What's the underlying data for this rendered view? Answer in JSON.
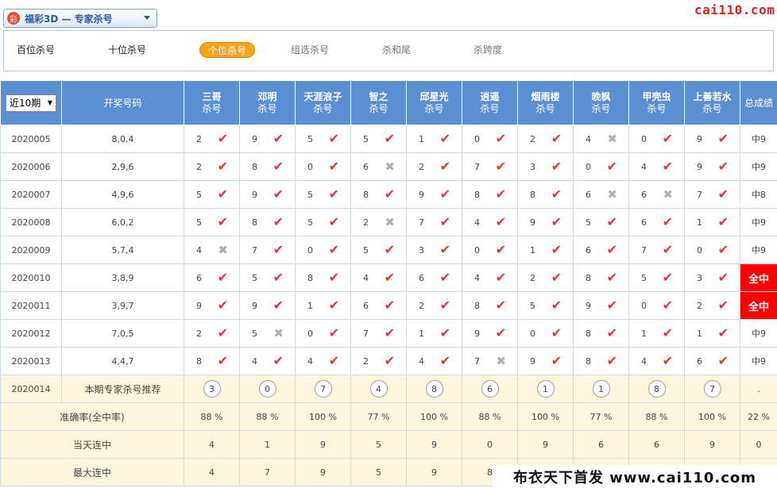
{
  "top": {
    "lottery_logo": "彩",
    "lottery_title": "福彩3D — 专家杀号",
    "site_logo": "cai110.com"
  },
  "tabs": [
    {
      "label": "百位杀号",
      "state": "normal"
    },
    {
      "label": "十位杀号",
      "state": "normal"
    },
    {
      "label": "个位杀号",
      "state": "active"
    },
    {
      "label": "组选杀号",
      "state": "inactive"
    },
    {
      "label": "杀和尾",
      "state": "inactive"
    },
    {
      "label": "杀跨度",
      "state": "inactive"
    }
  ],
  "header": {
    "period_select": "近10期",
    "draw_col": "开奖号码",
    "kill_suffix": "杀号",
    "total_col": "总成绩",
    "experts": [
      "三哥",
      "邓明",
      "天涯浪子",
      "智之",
      "邱星光",
      "逍遥",
      "烟雨楼",
      "晚枫",
      "甲壳虫",
      "上善若水"
    ]
  },
  "rows": [
    {
      "issue": "2020005",
      "draw": "8,0,4",
      "kills": [
        [
          "2",
          "ok"
        ],
        [
          "9",
          "ok"
        ],
        [
          "5",
          "ok"
        ],
        [
          "5",
          "ok"
        ],
        [
          "1",
          "ok"
        ],
        [
          "0",
          "ok"
        ],
        [
          "2",
          "ok"
        ],
        [
          "4",
          "bad"
        ],
        [
          "0",
          "ok"
        ],
        [
          "9",
          "ok"
        ]
      ],
      "total": "中9",
      "full": false
    },
    {
      "issue": "2020006",
      "draw": "2,9,6",
      "kills": [
        [
          "2",
          "ok"
        ],
        [
          "8",
          "ok"
        ],
        [
          "0",
          "ok"
        ],
        [
          "6",
          "bad"
        ],
        [
          "2",
          "ok"
        ],
        [
          "7",
          "ok"
        ],
        [
          "3",
          "ok"
        ],
        [
          "0",
          "ok"
        ],
        [
          "4",
          "ok"
        ],
        [
          "9",
          "ok"
        ]
      ],
      "total": "中9",
      "full": false
    },
    {
      "issue": "2020007",
      "draw": "4,9,6",
      "kills": [
        [
          "5",
          "ok"
        ],
        [
          "9",
          "ok"
        ],
        [
          "5",
          "ok"
        ],
        [
          "8",
          "ok"
        ],
        [
          "9",
          "ok"
        ],
        [
          "8",
          "ok"
        ],
        [
          "8",
          "ok"
        ],
        [
          "6",
          "bad"
        ],
        [
          "6",
          "bad"
        ],
        [
          "7",
          "ok"
        ]
      ],
      "total": "中8",
      "full": false
    },
    {
      "issue": "2020008",
      "draw": "6,0,2",
      "kills": [
        [
          "5",
          "ok"
        ],
        [
          "8",
          "ok"
        ],
        [
          "5",
          "ok"
        ],
        [
          "2",
          "bad"
        ],
        [
          "7",
          "ok"
        ],
        [
          "4",
          "ok"
        ],
        [
          "9",
          "ok"
        ],
        [
          "5",
          "ok"
        ],
        [
          "6",
          "ok"
        ],
        [
          "1",
          "ok"
        ]
      ],
      "total": "中9",
      "full": false
    },
    {
      "issue": "2020009",
      "draw": "5,7,4",
      "kills": [
        [
          "4",
          "bad"
        ],
        [
          "7",
          "ok"
        ],
        [
          "0",
          "ok"
        ],
        [
          "5",
          "ok"
        ],
        [
          "3",
          "ok"
        ],
        [
          "0",
          "ok"
        ],
        [
          "1",
          "ok"
        ],
        [
          "6",
          "ok"
        ],
        [
          "7",
          "ok"
        ],
        [
          "0",
          "ok"
        ]
      ],
      "total": "中9",
      "full": false
    },
    {
      "issue": "2020010",
      "draw": "3,8,9",
      "kills": [
        [
          "6",
          "ok"
        ],
        [
          "5",
          "ok"
        ],
        [
          "8",
          "ok"
        ],
        [
          "4",
          "ok"
        ],
        [
          "6",
          "ok"
        ],
        [
          "4",
          "ok"
        ],
        [
          "2",
          "ok"
        ],
        [
          "8",
          "ok"
        ],
        [
          "5",
          "ok"
        ],
        [
          "3",
          "ok"
        ]
      ],
      "total": "全中",
      "full": true
    },
    {
      "issue": "2020011",
      "draw": "3,9,7",
      "kills": [
        [
          "9",
          "ok"
        ],
        [
          "9",
          "ok"
        ],
        [
          "1",
          "ok"
        ],
        [
          "6",
          "ok"
        ],
        [
          "2",
          "ok"
        ],
        [
          "8",
          "ok"
        ],
        [
          "5",
          "ok"
        ],
        [
          "9",
          "ok"
        ],
        [
          "0",
          "ok"
        ],
        [
          "2",
          "ok"
        ]
      ],
      "total": "全中",
      "full": true
    },
    {
      "issue": "2020012",
      "draw": "7,0,5",
      "kills": [
        [
          "2",
          "ok"
        ],
        [
          "5",
          "bad"
        ],
        [
          "0",
          "ok"
        ],
        [
          "7",
          "ok"
        ],
        [
          "1",
          "ok"
        ],
        [
          "9",
          "ok"
        ],
        [
          "0",
          "ok"
        ],
        [
          "8",
          "ok"
        ],
        [
          "1",
          "ok"
        ],
        [
          "1",
          "ok"
        ]
      ],
      "total": "中9",
      "full": false
    },
    {
      "issue": "2020013",
      "draw": "4,4,7",
      "kills": [
        [
          "8",
          "ok"
        ],
        [
          "4",
          "ok"
        ],
        [
          "4",
          "ok"
        ],
        [
          "2",
          "ok"
        ],
        [
          "4",
          "ok"
        ],
        [
          "7",
          "bad"
        ],
        [
          "9",
          "ok"
        ],
        [
          "8",
          "ok"
        ],
        [
          "4",
          "ok"
        ],
        [
          "6",
          "ok"
        ]
      ],
      "total": "中9",
      "full": false
    }
  ],
  "recommend": {
    "issue": "2020014",
    "label": "本期专家杀号推荐",
    "values": [
      "3",
      "0",
      "7",
      "4",
      "8",
      "6",
      "1",
      "1",
      "8",
      "7"
    ],
    "total": "."
  },
  "accuracy": {
    "label": "准确率(全中率)",
    "values": [
      "88 %",
      "88 %",
      "100 %",
      "77 %",
      "100 %",
      "88 %",
      "100 %",
      "77 %",
      "88 %",
      "100 %"
    ],
    "total": "22 %"
  },
  "streak_today": {
    "label": "当天连中",
    "values": [
      "4",
      "1",
      "9",
      "5",
      "9",
      "0",
      "9",
      "6",
      "6",
      "9"
    ],
    "total": "0"
  },
  "streak_max": {
    "label": "最大连中",
    "values": [
      "4",
      "7",
      "9",
      "5",
      "9",
      "8",
      "",
      "",
      "",
      ""
    ],
    "total": ""
  },
  "footer_banner": "布衣天下首发 www.cai110.com",
  "icons": {
    "ok": "✔",
    "bad": "✖"
  },
  "colors": {
    "header_blue": "#5b8fd2",
    "ok_red": "#e8323c",
    "full_red": "#ff0000",
    "tab_orange": "#f7a31c",
    "foot_bg": "#fcf7dc"
  }
}
